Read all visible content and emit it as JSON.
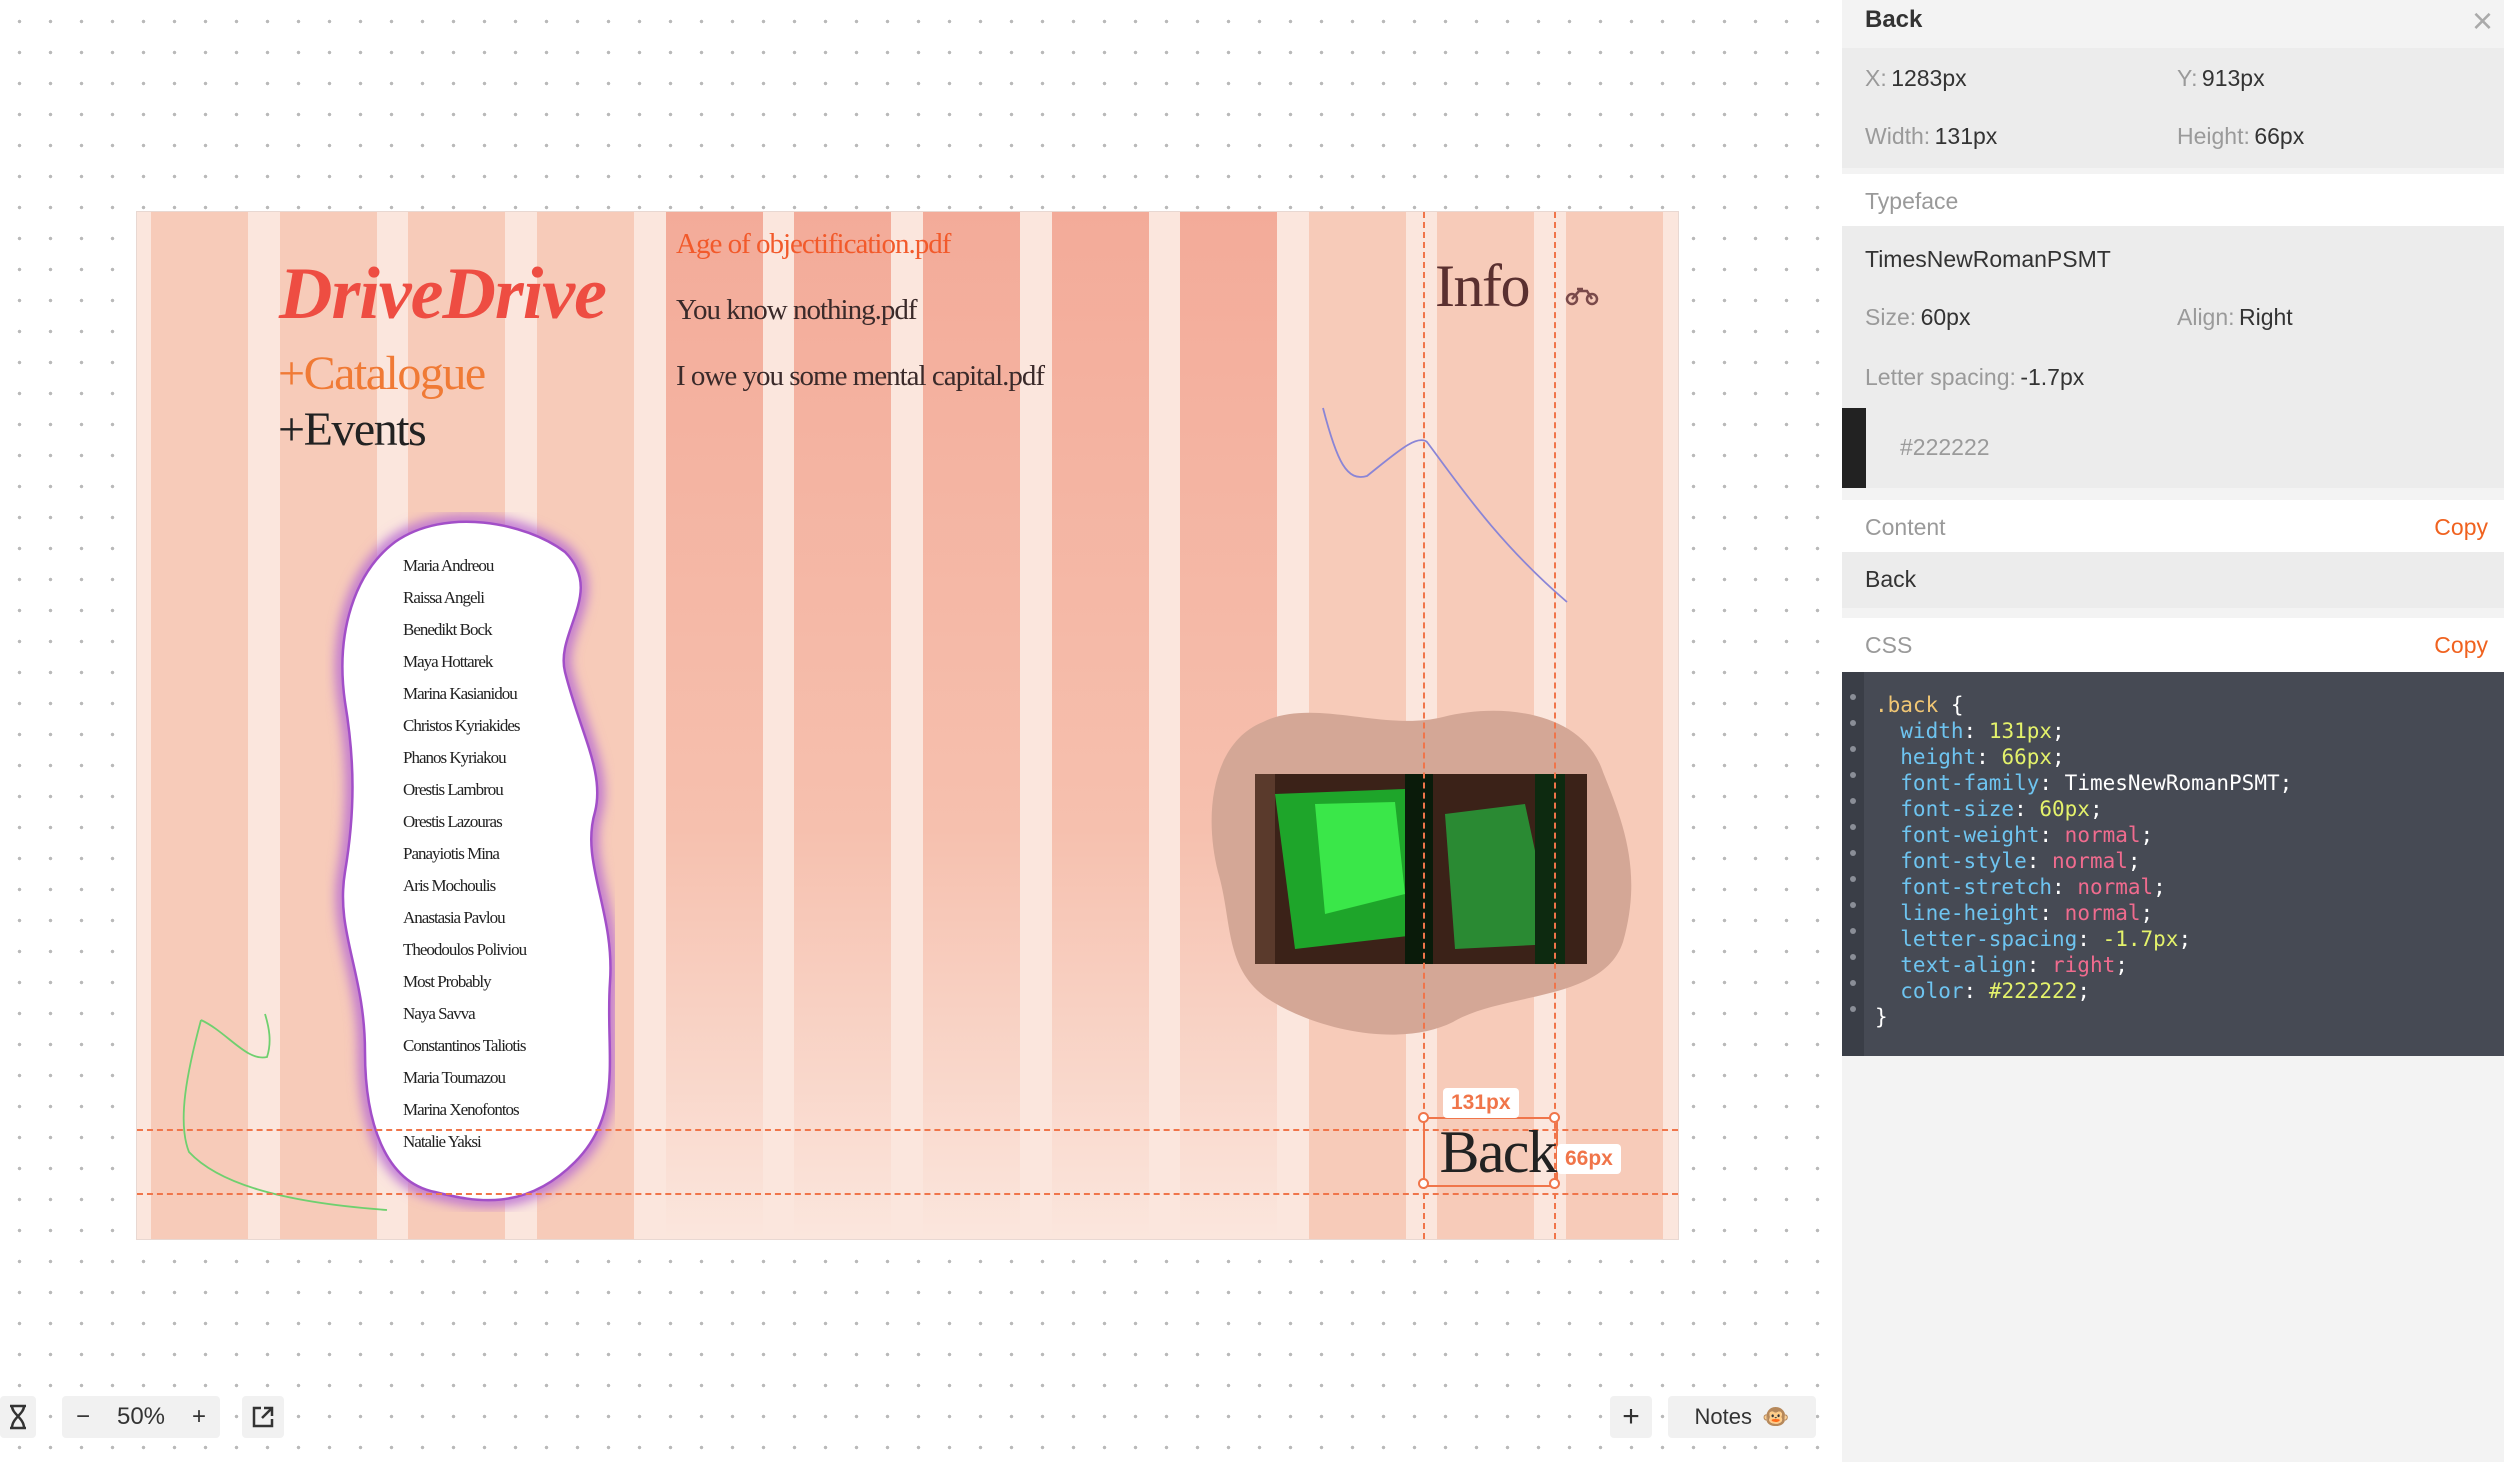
{
  "artboard": {
    "title": "DriveDrive",
    "catalogue": "+Catalogue",
    "events": "+Events",
    "pdfs": [
      "Age of objectification.pdf",
      "You know nothing.pdf",
      "I owe you some mental capital.pdf"
    ],
    "info": "Info",
    "names": [
      "Maria Andreou",
      "Raissa Angeli",
      "Benedikt Bock",
      "Maya Hottarek",
      "Marina Kasianidou",
      "Christos Kyriakides",
      "Phanos Kyriakou",
      "Orestis Lambrou",
      "Orestis Lazouras",
      "Panayiotis Mina",
      "Aris Mochoulis",
      "Anastasia Pavlou",
      "Theodoulos Poliviou",
      "Most Probably",
      "Naya Savva",
      "Constantinos Taliotis",
      "Maria Toumazou",
      "Marina Xenofontos",
      "Natalie Yaksi"
    ],
    "back_label": "Back",
    "width_tag": "131px",
    "height_tag": "66px"
  },
  "toolbar": {
    "zoom_minus": "−",
    "zoom_level": "50%",
    "zoom_plus": "+",
    "add": "+",
    "notes_label": "Notes",
    "notes_emoji": "🐵"
  },
  "inspector": {
    "title": "Back",
    "x_label": "X:",
    "x_value": "1283px",
    "y_label": "Y:",
    "y_value": "913px",
    "width_label": "Width:",
    "width_value": "131px",
    "height_label": "Height:",
    "height_value": "66px",
    "typeface_label": "Typeface",
    "typeface_value": "TimesNewRomanPSMT",
    "size_label": "Size:",
    "size_value": "60px",
    "align_label": "Align:",
    "align_value": "Right",
    "letter_spacing_label": "Letter spacing:",
    "letter_spacing_value": "-1.7px",
    "color_hex": "#222222",
    "content_label": "Content",
    "content_copy": "Copy",
    "content_value": "Back",
    "css_label": "CSS",
    "css_copy": "Copy",
    "css": {
      "selector": ".back",
      "rules": [
        {
          "prop": "width",
          "value": "131px",
          "kind": "num"
        },
        {
          "prop": "height",
          "value": "66px",
          "kind": "num"
        },
        {
          "prop": "font-family",
          "value": "TimesNewRomanPSMT",
          "kind": "str"
        },
        {
          "prop": "font-size",
          "value": "60px",
          "kind": "num"
        },
        {
          "prop": "font-weight",
          "value": "normal",
          "kind": "kw"
        },
        {
          "prop": "font-style",
          "value": "normal",
          "kind": "kw"
        },
        {
          "prop": "font-stretch",
          "value": "normal",
          "kind": "kw"
        },
        {
          "prop": "line-height",
          "value": "normal",
          "kind": "kw"
        },
        {
          "prop": "letter-spacing",
          "value": "-1.7px",
          "kind": "num"
        },
        {
          "prop": "text-align",
          "value": "right",
          "kind": "kw"
        },
        {
          "prop": "color",
          "value": "#222222",
          "kind": "num"
        }
      ]
    }
  },
  "colors": {
    "accent": "#f0754a",
    "brand_red": "#ee4d42",
    "swatch": "#222222"
  }
}
